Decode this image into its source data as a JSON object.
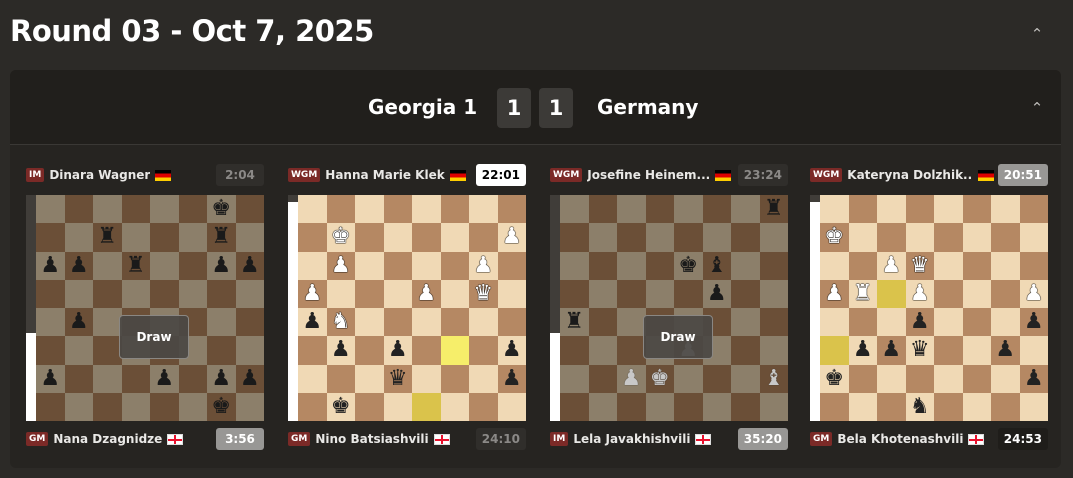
{
  "round": {
    "title": "Round 03 - Oct 7, 2025"
  },
  "match": {
    "team_home": "Georgia 1",
    "team_away": "Germany",
    "score_home": "1",
    "score_away": "1"
  },
  "games": [
    {
      "top": {
        "title": "IM",
        "name": "Dinara Wagner",
        "flag": "de",
        "clock": "2:04",
        "clock_style": "idle"
      },
      "bottom": {
        "title": "GM",
        "name": "Nana Dzagnidze",
        "flag": "ge",
        "clock": "3:56",
        "clock_style": "grey"
      },
      "result": "Draw",
      "eval_white": 0.39,
      "dim": true,
      "flipped": false,
      "fen": "6k1/2r3r1/pp1r2pp/8/1p6/8/p3p1pp/6k1",
      "highlights": []
    },
    {
      "top": {
        "title": "WGM",
        "name": "Hanna Marie Klek",
        "flag": "de",
        "clock": "22:01",
        "clock_style": "active"
      },
      "bottom": {
        "title": "GM",
        "name": "Nino Batsiashvili",
        "flag": "ge",
        "clock": "24:10",
        "clock_style": "idle"
      },
      "result": "",
      "eval_white": 0.97,
      "dim": false,
      "flipped": false,
      "fen": "8/1K5P/1P4P1/P3P1Q1/pN6n/1p1p3p/3q3p/1k6",
      "highlights": [
        [
          5,
          5
        ],
        [
          4,
          7
        ]
      ]
    },
    {
      "top": {
        "title": "WGM",
        "name": "Josefine Heinem...",
        "flag": "de",
        "clock": "23:24",
        "clock_style": "idle"
      },
      "bottom": {
        "title": "IM",
        "name": "Lela Javakhishvili",
        "flag": "ge",
        "clock": "35:20",
        "clock_style": "grey"
      },
      "result": "Draw",
      "eval_white": 0.39,
      "dim": true,
      "flipped": false,
      "fen": "7r/8/4kb2/5p2/r7/4P3/2PK3B/8",
      "highlights": []
    },
    {
      "top": {
        "title": "WGM",
        "name": "Kateryna Dolzhik...",
        "flag": "de",
        "clock": "20:51",
        "clock_style": "grey"
      },
      "bottom": {
        "title": "GM",
        "name": "Bela Khotenashvili",
        "flag": "ge",
        "clock": "24:53",
        "clock_style": "dark"
      },
      "result": "",
      "eval_white": 0.97,
      "dim": false,
      "flipped": false,
      "fen": "8/K7/2PQ4/PR1P3P/3p3p/1ppq2p1/k6p/3n4",
      "highlights": [
        [
          0,
          5
        ],
        [
          2,
          3
        ]
      ]
    }
  ]
}
